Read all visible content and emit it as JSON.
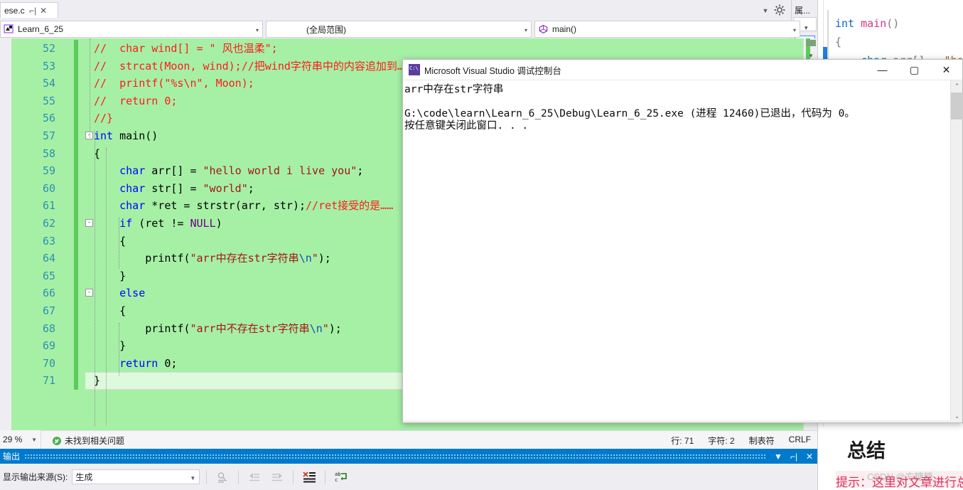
{
  "tab": {
    "label": "ese.c",
    "pin_icon": "pin-icon",
    "close_icon": "close-icon"
  },
  "navbar": {
    "project": "Learn_6_25",
    "scope": "(全局范围)",
    "member": "main()",
    "project_icon": "project-icon",
    "member_icon": "method-icon",
    "split_icon": "split-window-icon",
    "caret": "▾"
  },
  "right_dock": {
    "title": "属...",
    "caret": "▾",
    "button_icon": "properties-grid-icon"
  },
  "editor": {
    "zoom": "29 %",
    "issue_status": "未找到相关问题",
    "line_status": "行: 71",
    "char_status": "字符: 2",
    "tab_status": "制表符",
    "eol_status": "CRLF",
    "first_line_number": 52,
    "lines": [
      {
        "n": 52,
        "changed": true,
        "fold": "",
        "tokens": [
          {
            "t": "//  ",
            "c": "cmt"
          },
          {
            "t": "char wind[] = \" 风也温柔\";",
            "c": "cmt"
          }
        ]
      },
      {
        "n": 53,
        "changed": true,
        "fold": "",
        "tokens": [
          {
            "t": "//  strcat(Moon, wind);//把wind字符串中的内容追加到……的词尾后",
            "c": "cmt"
          }
        ]
      },
      {
        "n": 54,
        "changed": true,
        "fold": "",
        "tokens": [
          {
            "t": "//  printf(\"%s\\n\", Moon);",
            "c": "cmt"
          }
        ]
      },
      {
        "n": 55,
        "changed": true,
        "fold": "",
        "tokens": [
          {
            "t": "//  return 0;",
            "c": "cmt"
          }
        ]
      },
      {
        "n": 56,
        "changed": true,
        "fold": "",
        "tokens": [
          {
            "t": "//}",
            "c": "cmt"
          }
        ]
      },
      {
        "n": 57,
        "changed": true,
        "fold": "-",
        "tokens": [
          {
            "t": "int",
            "c": "kw"
          },
          {
            "t": " ",
            "c": "pln"
          },
          {
            "t": "main",
            "c": "pln"
          },
          {
            "t": "()",
            "c": "pln"
          }
        ]
      },
      {
        "n": 58,
        "changed": true,
        "fold": "",
        "tokens": [
          {
            "t": "{",
            "c": "pln"
          }
        ]
      },
      {
        "n": 59,
        "changed": true,
        "fold": "",
        "tokens": [
          {
            "t": "    ",
            "c": "pln"
          },
          {
            "t": "char",
            "c": "kw"
          },
          {
            "t": " arr[] = ",
            "c": "pln"
          },
          {
            "t": "\"hello world i live you\"",
            "c": "str"
          },
          {
            "t": ";",
            "c": "pln"
          }
        ]
      },
      {
        "n": 60,
        "changed": true,
        "fold": "",
        "tokens": [
          {
            "t": "    ",
            "c": "pln"
          },
          {
            "t": "char",
            "c": "kw"
          },
          {
            "t": " str[] = ",
            "c": "pln"
          },
          {
            "t": "\"world\"",
            "c": "str"
          },
          {
            "t": ";",
            "c": "pln"
          }
        ]
      },
      {
        "n": 61,
        "changed": true,
        "fold": "",
        "tokens": [
          {
            "t": "    ",
            "c": "pln"
          },
          {
            "t": "char",
            "c": "kw"
          },
          {
            "t": " *ret = ",
            "c": "pln"
          },
          {
            "t": "strstr",
            "c": "pln"
          },
          {
            "t": "(arr, str);",
            "c": "pln"
          },
          {
            "t": "//ret接受的是……",
            "c": "cmt"
          }
        ]
      },
      {
        "n": 62,
        "changed": true,
        "fold": "-",
        "tokens": [
          {
            "t": "    ",
            "c": "pln"
          },
          {
            "t": "if",
            "c": "kw"
          },
          {
            "t": " (ret != ",
            "c": "pln"
          },
          {
            "t": "NULL",
            "c": "mac"
          },
          {
            "t": ")",
            "c": "pln"
          }
        ]
      },
      {
        "n": 63,
        "changed": true,
        "fold": "",
        "tokens": [
          {
            "t": "    {",
            "c": "pln"
          }
        ]
      },
      {
        "n": 64,
        "changed": true,
        "fold": "",
        "tokens": [
          {
            "t": "        ",
            "c": "pln"
          },
          {
            "t": "printf",
            "c": "pln"
          },
          {
            "t": "(",
            "c": "pln"
          },
          {
            "t": "\"arr中存在str字符串",
            "c": "str"
          },
          {
            "t": "\\n",
            "c": "esc"
          },
          {
            "t": "\"",
            "c": "str"
          },
          {
            "t": ");",
            "c": "pln"
          }
        ]
      },
      {
        "n": 65,
        "changed": true,
        "fold": "",
        "tokens": [
          {
            "t": "    }",
            "c": "pln"
          }
        ]
      },
      {
        "n": 66,
        "changed": true,
        "fold": "-",
        "tokens": [
          {
            "t": "    ",
            "c": "pln"
          },
          {
            "t": "else",
            "c": "kw"
          }
        ]
      },
      {
        "n": 67,
        "changed": true,
        "fold": "",
        "tokens": [
          {
            "t": "    {",
            "c": "pln"
          }
        ]
      },
      {
        "n": 68,
        "changed": true,
        "fold": "",
        "tokens": [
          {
            "t": "        ",
            "c": "pln"
          },
          {
            "t": "printf",
            "c": "pln"
          },
          {
            "t": "(",
            "c": "pln"
          },
          {
            "t": "\"arr中不存在str字符串",
            "c": "str"
          },
          {
            "t": "\\n",
            "c": "esc"
          },
          {
            "t": "\"",
            "c": "str"
          },
          {
            "t": ");",
            "c": "pln"
          }
        ]
      },
      {
        "n": 69,
        "changed": true,
        "fold": "",
        "tokens": [
          {
            "t": "    }",
            "c": "pln"
          }
        ]
      },
      {
        "n": 70,
        "changed": true,
        "fold": "",
        "tokens": [
          {
            "t": "    ",
            "c": "pln"
          },
          {
            "t": "return",
            "c": "kw"
          },
          {
            "t": " 0;",
            "c": "pln"
          }
        ]
      },
      {
        "n": 71,
        "changed": true,
        "fold": "",
        "caret": true,
        "tokens": [
          {
            "t": "}",
            "c": "pln"
          }
        ]
      }
    ]
  },
  "output": {
    "title": "输出",
    "caret_icon": "chevron-down-icon",
    "pin_icon": "pin-icon",
    "close_icon": "close-icon",
    "source_label": "显示输出来源(S):",
    "source_value": "生成",
    "icons": [
      "find-message-icon",
      "go-to-previous-message-icon",
      "go-to-next-message-icon",
      "clear-all-icon",
      "toggle-word-wrap-icon"
    ]
  },
  "console": {
    "title": "Microsoft Visual Studio 调试控制台",
    "app_icon": "console-app-icon",
    "minimize": "—",
    "maximize": "▢",
    "close": "✕",
    "output_lines": [
      "arr中存在str字符串",
      "",
      "G:\\code\\learn\\Learn_6_25\\Debug\\Learn_6_25.exe (进程 12460)已退出，代码为 0。",
      "按任意键关闭此窗口. . ."
    ]
  },
  "right_pane": {
    "code_lines": [
      [
        {
          "t": "int ",
          "c": "kw-blue"
        },
        {
          "t": "main",
          "c": "kw-pink"
        },
        {
          "t": "()",
          "c": "kw-grey"
        }
      ],
      [
        {
          "t": "{",
          "c": "kw-grey"
        }
      ],
      [
        {
          "t": "    ",
          "c": "kw-grey"
        },
        {
          "t": "char ",
          "c": "kw-teal"
        },
        {
          "t": "arr",
          "c": "kw-grey"
        },
        {
          "t": "[] = ",
          "c": "kw-grey"
        },
        {
          "t": "\"he",
          "c": "kw-brown"
        }
      ]
    ],
    "summary_heading": "总结",
    "tip_text": "提示：这里对文章进行总结",
    "watermark": "CSDN @方糖糖"
  },
  "colors": {
    "editor_background": "#a6f0a6",
    "comment": "#ff1a1a",
    "keyword": "#0000ff",
    "string": "#a31515",
    "macro": "#6f008a",
    "line_number": "#2b91af",
    "change_bar": "#5bcc5b",
    "output_title_bar": "#007acc",
    "tip": "#e0305a"
  }
}
